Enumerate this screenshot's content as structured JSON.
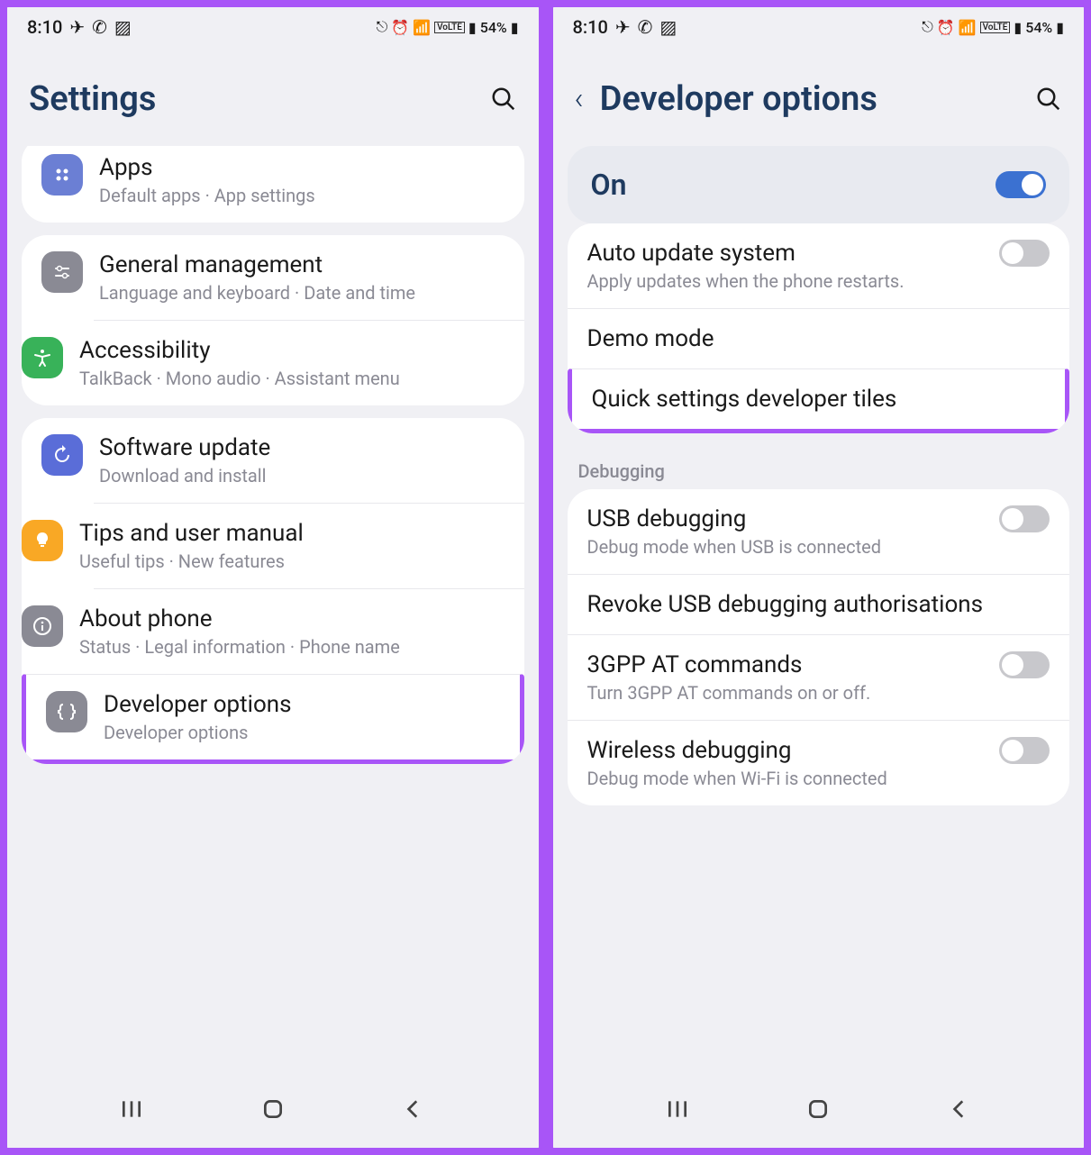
{
  "status": {
    "time": "8:10",
    "battery_pct": "54%"
  },
  "left": {
    "title": "Settings",
    "groups": [
      {
        "rows": [
          {
            "icon": "apps",
            "color": "blue",
            "title": "Apps",
            "sub": "Default apps  ·  App settings"
          }
        ]
      },
      {
        "rows": [
          {
            "icon": "sliders",
            "color": "gray",
            "title": "General management",
            "sub": "Language and keyboard  ·  Date and time"
          },
          {
            "icon": "accessibility",
            "color": "green",
            "title": "Accessibility",
            "sub": "TalkBack  ·  Mono audio  ·  Assistant menu"
          }
        ]
      },
      {
        "rows": [
          {
            "icon": "refresh",
            "color": "bluebr",
            "title": "Software update",
            "sub": "Download and install"
          },
          {
            "icon": "bulb",
            "color": "orange",
            "title": "Tips and user manual",
            "sub": "Useful tips  ·  New features"
          },
          {
            "icon": "info",
            "color": "gray",
            "title": "About phone",
            "sub": "Status  ·  Legal information  ·  Phone name"
          },
          {
            "icon": "braces",
            "color": "gray",
            "title": "Developer options",
            "sub": "Developer options",
            "highlight": true
          }
        ]
      }
    ]
  },
  "right": {
    "title": "Developer options",
    "on_label": "On",
    "rows": [
      {
        "title": "Auto update system",
        "sub": "Apply updates when the phone restarts.",
        "toggle": "off"
      },
      {
        "title": "Demo mode"
      },
      {
        "title": "Quick settings developer tiles",
        "highlight": true
      }
    ],
    "section2_header": "Debugging",
    "rows2": [
      {
        "title": "USB debugging",
        "sub": "Debug mode when USB is connected",
        "toggle": "off"
      },
      {
        "title": "Revoke USB debugging authorisations"
      },
      {
        "title": "3GPP AT commands",
        "sub": "Turn 3GPP AT commands on or off.",
        "toggle": "off"
      },
      {
        "title": "Wireless debugging",
        "sub": "Debug mode when Wi-Fi is connected",
        "toggle": "off"
      }
    ]
  }
}
